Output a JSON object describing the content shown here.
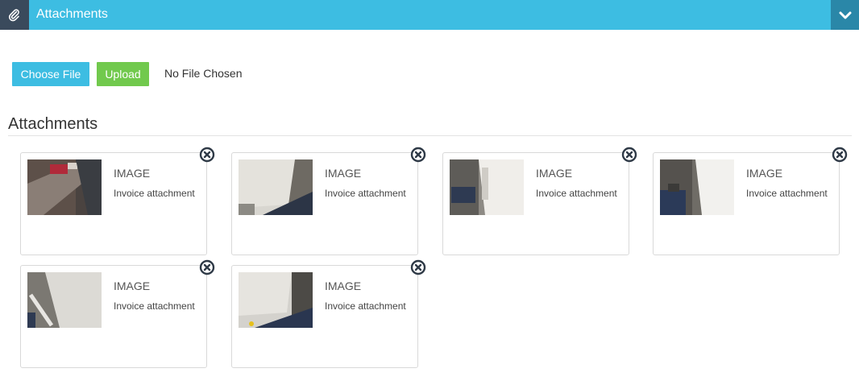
{
  "header": {
    "icon": "paperclip-icon",
    "title": "Attachments",
    "toggle_icon": "chevron-down-icon",
    "color": "#3dbde2"
  },
  "upload": {
    "choose_label": "Choose File",
    "upload_label": "Upload",
    "status_text": "No File Chosen"
  },
  "section": {
    "title": "Attachments"
  },
  "attachments": [
    {
      "type": "IMAGE",
      "description": "Invoice attachment"
    },
    {
      "type": "IMAGE",
      "description": "Invoice attachment"
    },
    {
      "type": "IMAGE",
      "description": "Invoice attachment"
    },
    {
      "type": "IMAGE",
      "description": "Invoice attachment"
    },
    {
      "type": "IMAGE",
      "description": "Invoice attachment"
    },
    {
      "type": "IMAGE",
      "description": "Invoice attachment"
    }
  ]
}
